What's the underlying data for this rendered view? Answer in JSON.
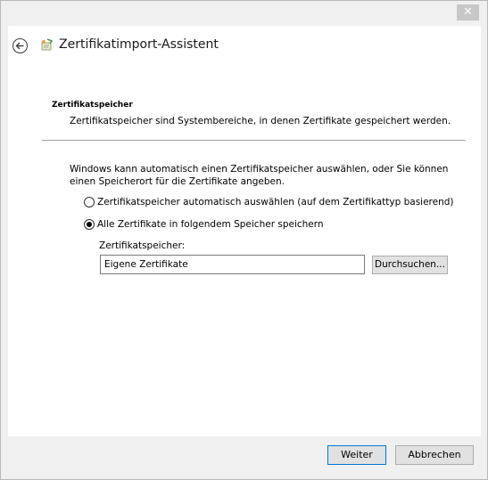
{
  "window": {
    "close_glyph": "✕"
  },
  "header": {
    "title": "Zertifikatimport-Assistent",
    "back_icon": "back-arrow-icon",
    "app_icon": "certificate-wizard-icon"
  },
  "section": {
    "title": "Zertifikatspeicher",
    "description": "Zertifikatspeicher sind Systembereiche, in denen Zertifikate gespeichert werden."
  },
  "intro": "Windows kann automatisch einen Zertifikatspeicher auswählen, oder Sie können einen Speicherort für die Zertifikate angeben.",
  "options": [
    {
      "label": "Zertifikatspeicher automatisch auswählen (auf dem Zertifikattyp basierend)",
      "checked": false
    },
    {
      "label": "Alle Zertifikate in folgendem Speicher speichern",
      "checked": true
    }
  ],
  "store": {
    "label": "Zertifikatspeicher:",
    "value": "Eigene Zertifikate",
    "browse_label": "Durchsuchen..."
  },
  "footer": {
    "next_label": "Weiter",
    "cancel_label": "Abbrechen"
  },
  "colors": {
    "primary_border": "#0078d7",
    "close_bg": "#c7c7c7"
  }
}
